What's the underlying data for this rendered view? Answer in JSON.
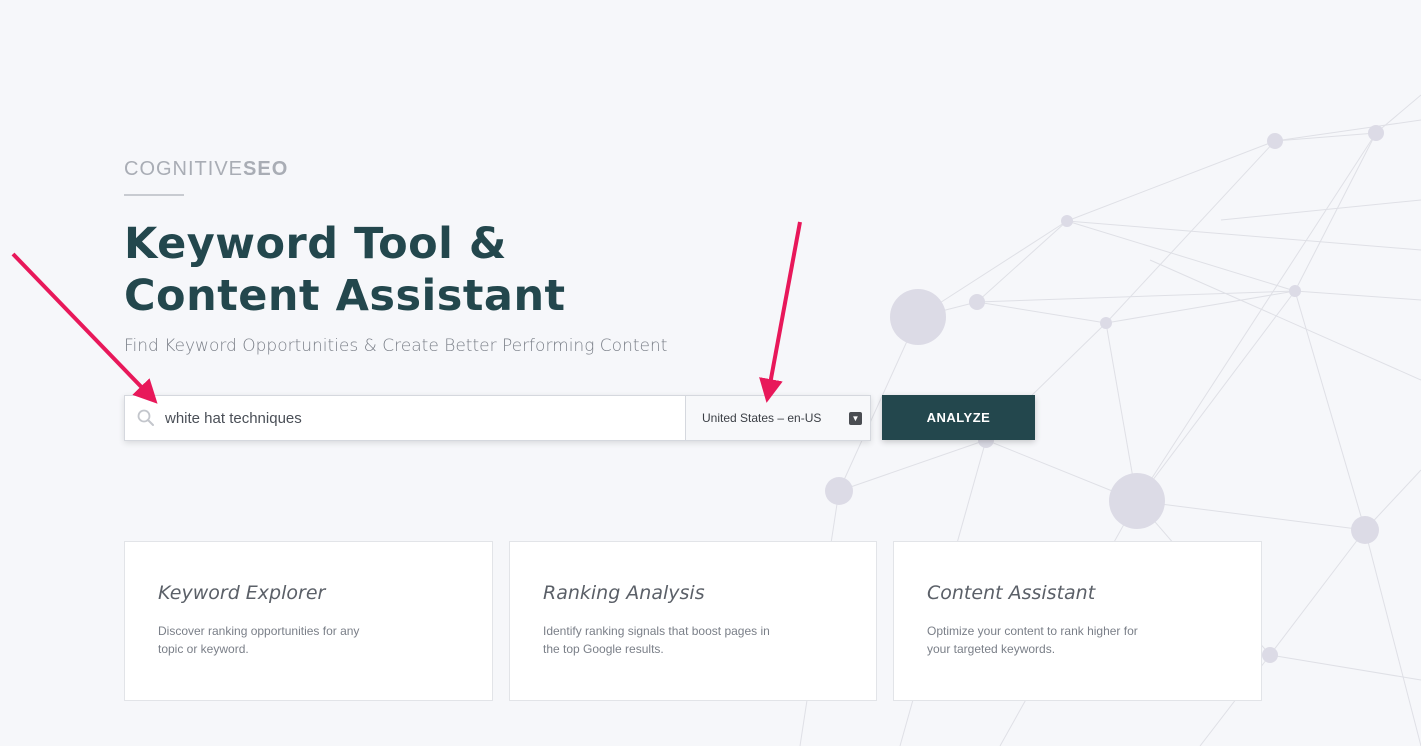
{
  "brand": {
    "light": "COGNITIVE",
    "bold": "SEO"
  },
  "hero": {
    "title_line1": "Keyword Tool &",
    "title_line2": "Content Assistant",
    "subtitle": "Find Keyword Opportunities & Create Better Performing Content"
  },
  "search": {
    "value": "white hat techniques",
    "icon": "search-icon",
    "locale": "United States – en-US",
    "analyze_label": "ANALYZE"
  },
  "cards": [
    {
      "title": "Keyword Explorer",
      "description": "Discover ranking opportunities for any topic or keyword."
    },
    {
      "title": "Ranking Analysis",
      "description": "Identify ranking signals that boost pages in the top Google results."
    },
    {
      "title": "Content Assistant",
      "description": "Optimize your content to rank higher for your targeted keywords."
    }
  ],
  "colors": {
    "accent": "#23474d",
    "background": "#f6f7fa",
    "annotation_arrow": "#e8185a",
    "network_node": "#dcdbe6"
  }
}
